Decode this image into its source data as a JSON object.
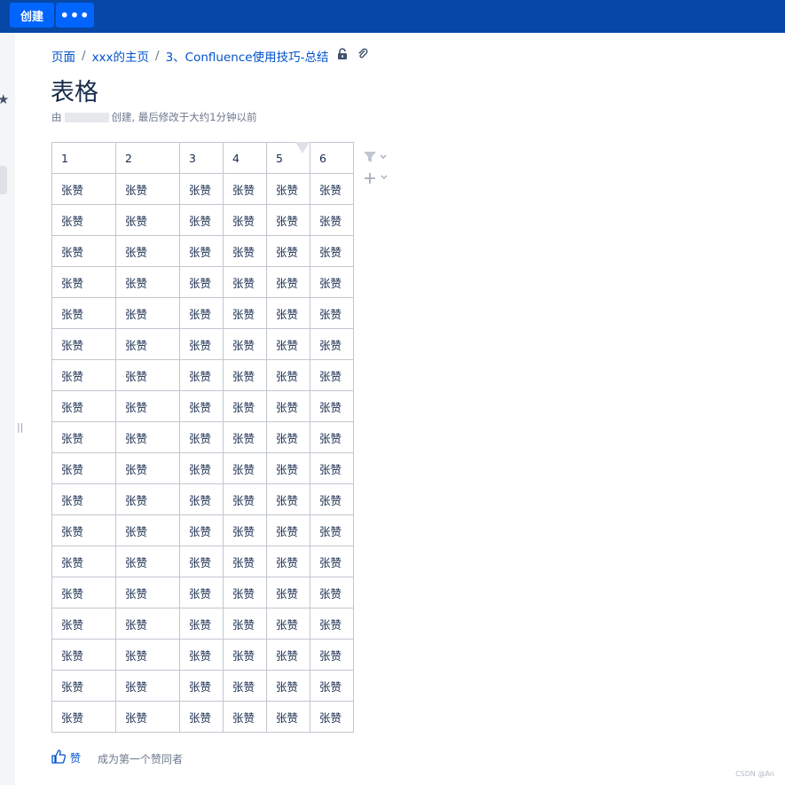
{
  "topbar": {
    "create_label": "创建",
    "more_label": "•••"
  },
  "breadcrumbs": [
    "页面",
    "xxx的主页",
    "3、Confluence使用技巧-总结"
  ],
  "breadcrumb_sep": "/",
  "page": {
    "title": "表格",
    "byline_prefix": "由",
    "byline_suffix": "创建, 最后修改于大约1分钟以前"
  },
  "table": {
    "headers": [
      "1",
      "2",
      "3",
      "4",
      "5",
      "6"
    ],
    "cell_text": "张赞",
    "row_count": 18
  },
  "footer": {
    "like_label": "赞",
    "like_first": "成为第一个赞同者"
  },
  "watermark": "CSDN @An",
  "icons": {
    "star": "star-icon",
    "lock": "unlock-icon",
    "attach": "paperclip-icon",
    "filter": "filter-icon",
    "add": "plus-icon",
    "like": "thumbs-up-icon"
  }
}
